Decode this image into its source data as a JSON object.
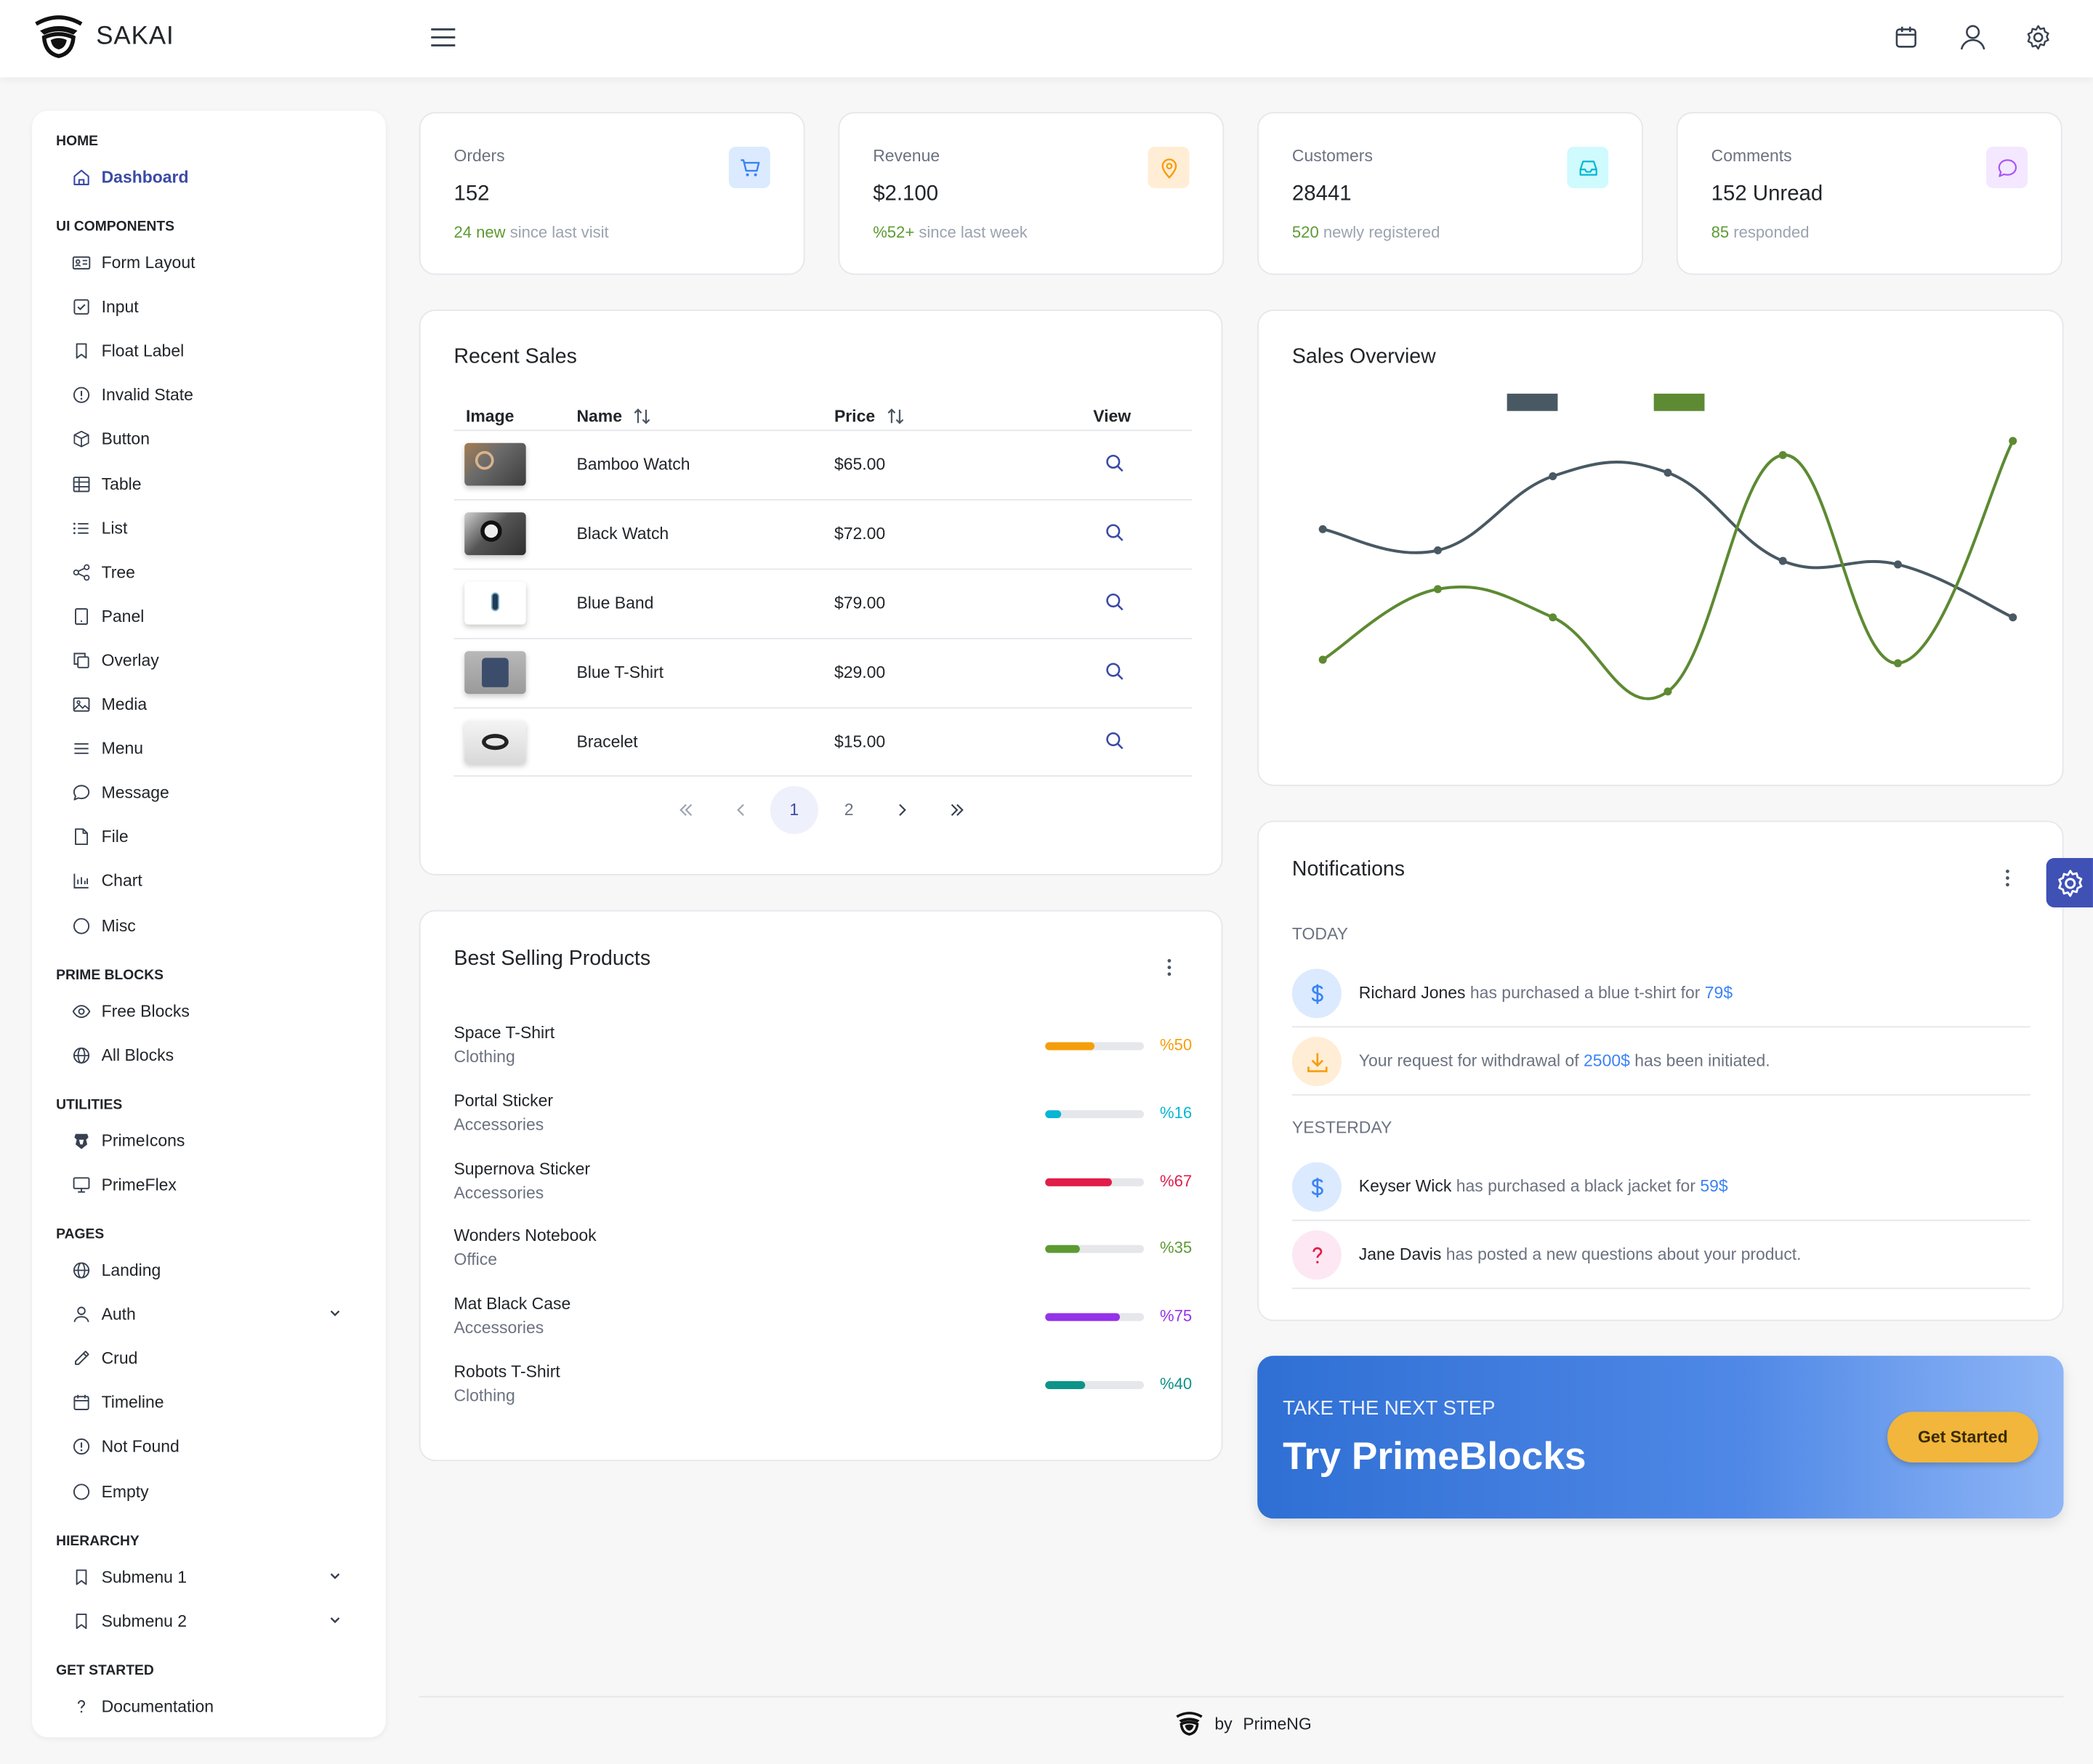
{
  "app": {
    "name": "SAKAI"
  },
  "sidebar": {
    "sections": [
      {
        "title": "HOME",
        "items": [
          {
            "label": "Dashboard",
            "icon": "home-icon",
            "active": true
          }
        ]
      },
      {
        "title": "UI COMPONENTS",
        "items": [
          {
            "label": "Form Layout",
            "icon": "id-card-icon"
          },
          {
            "label": "Input",
            "icon": "check-square-icon"
          },
          {
            "label": "Float Label",
            "icon": "bookmark-icon"
          },
          {
            "label": "Invalid State",
            "icon": "exclamation-circle-icon"
          },
          {
            "label": "Button",
            "icon": "box-icon"
          },
          {
            "label": "Table",
            "icon": "table-icon"
          },
          {
            "label": "List",
            "icon": "list-icon"
          },
          {
            "label": "Tree",
            "icon": "share-alt-icon"
          },
          {
            "label": "Panel",
            "icon": "tablet-icon"
          },
          {
            "label": "Overlay",
            "icon": "clone-icon"
          },
          {
            "label": "Media",
            "icon": "image-icon"
          },
          {
            "label": "Menu",
            "icon": "bars-icon"
          },
          {
            "label": "Message",
            "icon": "comment-icon"
          },
          {
            "label": "File",
            "icon": "file-icon"
          },
          {
            "label": "Chart",
            "icon": "chart-bar-icon"
          },
          {
            "label": "Misc",
            "icon": "circle-icon"
          }
        ]
      },
      {
        "title": "PRIME BLOCKS",
        "items": [
          {
            "label": "Free Blocks",
            "icon": "eye-icon"
          },
          {
            "label": "All Blocks",
            "icon": "globe-icon"
          }
        ]
      },
      {
        "title": "UTILITIES",
        "items": [
          {
            "label": "PrimeIcons",
            "icon": "prime-icon"
          },
          {
            "label": "PrimeFlex",
            "icon": "desktop-icon"
          }
        ]
      },
      {
        "title": "PAGES",
        "items": [
          {
            "label": "Landing",
            "icon": "globe-icon"
          },
          {
            "label": "Auth",
            "icon": "user-icon",
            "expandable": true
          },
          {
            "label": "Crud",
            "icon": "pencil-icon"
          },
          {
            "label": "Timeline",
            "icon": "calendar-icon"
          },
          {
            "label": "Not Found",
            "icon": "exclamation-circle-icon"
          },
          {
            "label": "Empty",
            "icon": "circle-icon"
          }
        ]
      },
      {
        "title": "HIERARCHY",
        "items": [
          {
            "label": "Submenu 1",
            "icon": "bookmark-icon",
            "expandable": true
          },
          {
            "label": "Submenu 2",
            "icon": "bookmark-icon",
            "expandable": true
          }
        ]
      },
      {
        "title": "GET STARTED",
        "items": [
          {
            "label": "Documentation",
            "icon": "question-icon"
          }
        ]
      }
    ]
  },
  "stats": [
    {
      "label": "Orders",
      "value": "152",
      "highlight": "24 new",
      "rest": " since last visit",
      "icon": "shopping-cart-icon",
      "icon_color": "#3b82f6",
      "icon_bg": "#dbeafe"
    },
    {
      "label": "Revenue",
      "value": "$2.100",
      "highlight": "%52+",
      "rest": " since last week",
      "icon": "map-marker-icon",
      "icon_color": "#f59e0b",
      "icon_bg": "#ffedd5"
    },
    {
      "label": "Customers",
      "value": "28441",
      "highlight": "520",
      "rest": " newly registered",
      "icon": "inbox-icon",
      "icon_color": "#06b6d4",
      "icon_bg": "#cffafe"
    },
    {
      "label": "Comments",
      "value": "152 Unread",
      "highlight": "85",
      "rest": " responded",
      "icon": "comment-icon",
      "icon_color": "#a855f7",
      "icon_bg": "#f3e8ff"
    }
  ],
  "recent_sales": {
    "title": "Recent Sales",
    "columns": {
      "image": "Image",
      "name": "Name",
      "price": "Price",
      "view": "View"
    },
    "rows": [
      {
        "name": "Bamboo Watch",
        "price": "$65.00"
      },
      {
        "name": "Black Watch",
        "price": "$72.00"
      },
      {
        "name": "Blue Band",
        "price": "$79.00"
      },
      {
        "name": "Blue T-Shirt",
        "price": "$29.00"
      },
      {
        "name": "Bracelet",
        "price": "$15.00"
      }
    ],
    "pages": [
      "1",
      "2"
    ],
    "current_page": "1"
  },
  "best_selling": {
    "title": "Best Selling Products",
    "items": [
      {
        "name": "Space T-Shirt",
        "category": "Clothing",
        "percent": 50,
        "label": "%50",
        "color": "#f59e0b"
      },
      {
        "name": "Portal Sticker",
        "category": "Accessories",
        "percent": 16,
        "label": "%16",
        "color": "#06b6d4"
      },
      {
        "name": "Supernova Sticker",
        "category": "Accessories",
        "percent": 67,
        "label": "%67",
        "color": "#e11d48"
      },
      {
        "name": "Wonders Notebook",
        "category": "Office",
        "percent": 35,
        "label": "%35",
        "color": "#5d9a32"
      },
      {
        "name": "Mat Black Case",
        "category": "Accessories",
        "percent": 75,
        "label": "%75",
        "color": "#9333ea"
      },
      {
        "name": "Robots T-Shirt",
        "category": "Clothing",
        "percent": 40,
        "label": "%40",
        "color": "#0d9488"
      }
    ]
  },
  "sales_overview": {
    "title": "Sales Overview"
  },
  "chart_data": {
    "type": "line",
    "title": "Sales Overview",
    "x": [
      1,
      2,
      3,
      4,
      5,
      6,
      7
    ],
    "series": [
      {
        "values": [
          65,
          59,
          80,
          81,
          56,
          55,
          40
        ],
        "color": "#495963"
      },
      {
        "values": [
          28,
          48,
          40,
          19,
          86,
          27,
          90
        ],
        "color": "#5d8a32"
      }
    ],
    "ylim": [
      10,
      100
    ],
    "legend": "top",
    "grid": false,
    "smooth": true
  },
  "notifications": {
    "title": "Notifications",
    "groups": [
      {
        "label": "TODAY",
        "items": [
          {
            "icon": "dollar-icon",
            "color": "#3b82f6",
            "bg": "#dbeafe",
            "strong": "Richard Jones",
            "text": " has purchased a blue t-shirt for ",
            "link": "79$",
            "after": ""
          },
          {
            "icon": "download-icon",
            "color": "#f59e0b",
            "bg": "#ffedd5",
            "strong": "",
            "text": "Your request for withdrawal of ",
            "link": "2500$",
            "after": " has been initiated."
          }
        ]
      },
      {
        "label": "YESTERDAY",
        "items": [
          {
            "icon": "dollar-icon",
            "color": "#3b82f6",
            "bg": "#dbeafe",
            "strong": "Keyser Wick",
            "text": " has purchased a black jacket for ",
            "link": "59$",
            "after": ""
          },
          {
            "icon": "question-icon",
            "color": "#e11d48",
            "bg": "#fce7f3",
            "strong": "Jane Davis",
            "text": " has posted a new questions about your product.",
            "link": "",
            "after": ""
          }
        ]
      }
    ]
  },
  "promo": {
    "kicker": "TAKE THE NEXT STEP",
    "title": "Try PrimeBlocks",
    "button": "Get Started"
  },
  "footer": {
    "by": "by",
    "brand": "PrimeNG"
  }
}
